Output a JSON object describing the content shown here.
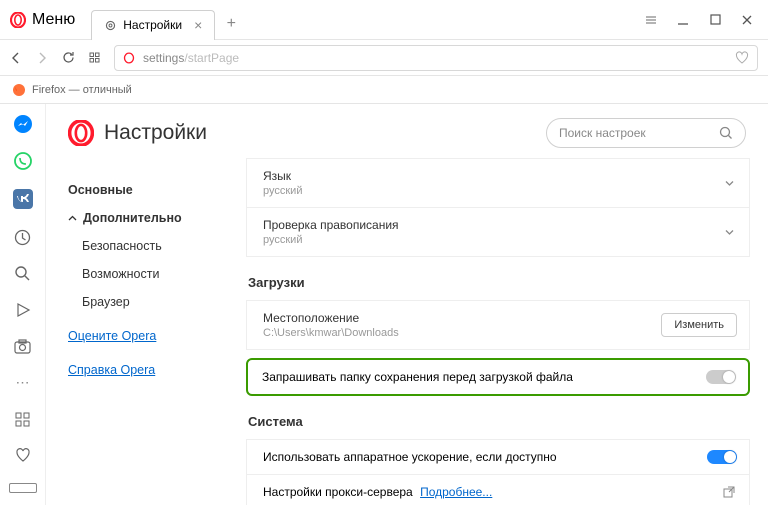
{
  "titlebar": {
    "menu_label": "Меню",
    "tab_label": "Настройки"
  },
  "addressbar": {
    "url_host": "settings",
    "url_path": "/startPage"
  },
  "bookmarks": {
    "item1": "Firefox — отличный"
  },
  "header": {
    "title": "Настройки",
    "search_placeholder": "Поиск настроек"
  },
  "nav": {
    "main": "Основные",
    "advanced": "Дополнительно",
    "security": "Безопасность",
    "features": "Возможности",
    "browser": "Браузер",
    "rate": "Оцените Opera",
    "help": "Справка Opera"
  },
  "panel": {
    "language_label": "Язык",
    "language_value": "русский",
    "spell_label": "Проверка правописания",
    "spell_value": "русский",
    "downloads_section": "Загрузки",
    "location_label": "Местоположение",
    "location_value": "C:\\Users\\kmwar\\Downloads",
    "change_btn": "Изменить",
    "ask_folder": "Запрашивать папку сохранения перед загрузкой файла",
    "system_section": "Система",
    "hw_accel": "Использовать аппаратное ускорение, если доступно",
    "proxy_label": "Настройки прокси-сервера",
    "proxy_link": "Подробнее..."
  }
}
